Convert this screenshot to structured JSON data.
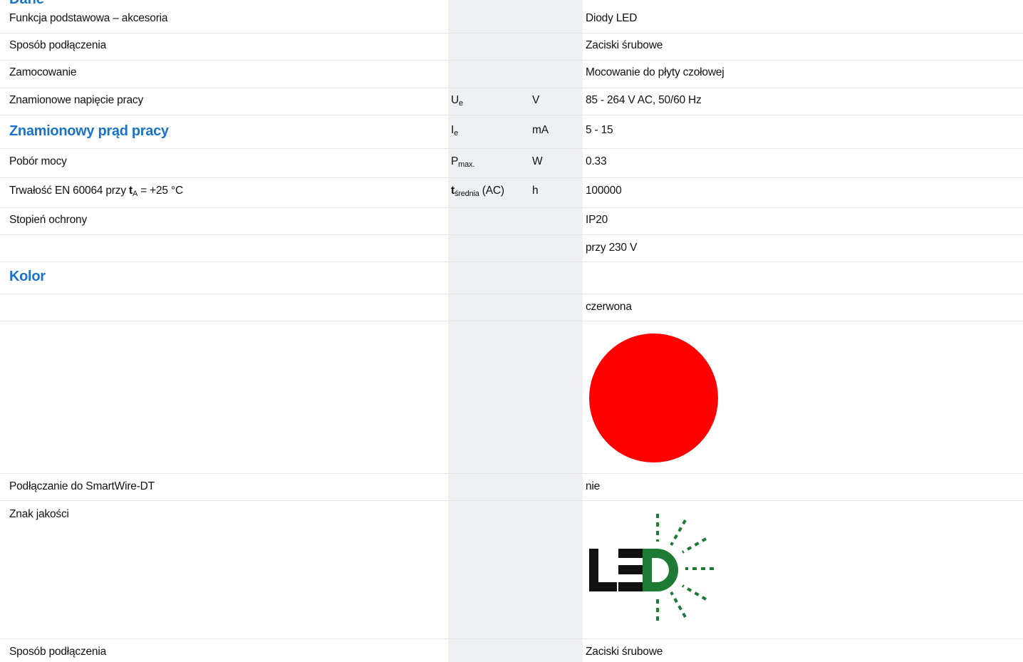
{
  "header_fragment": "Dane",
  "rows": [
    {
      "label": "Funkcja podstawowa – akcesoria",
      "symbol": "",
      "unit": "",
      "value": "Diody LED"
    },
    {
      "label": "Sposób podłączenia",
      "symbol": "",
      "unit": "",
      "value": "Zaciski śrubowe"
    },
    {
      "label": "Zamocowanie",
      "symbol": "",
      "unit": "",
      "value": "Mocowanie do płyty czołowej"
    },
    {
      "label": "Znamionowe napięcie pracy",
      "symbol": "U",
      "symbol_sub": "e",
      "unit": "V",
      "value": "85 - 264 V AC, 50/60 Hz"
    },
    {
      "label": "Znamionowy prąd pracy",
      "symbol": "I",
      "symbol_sub": "e",
      "unit": "mA",
      "value": "5 - 15"
    },
    {
      "label": "Pobór mocy",
      "symbol": "P",
      "symbol_sub": "max.",
      "unit": "W",
      "value": "0.33"
    },
    {
      "label_pre": "Trwałość EN 60064 przy ",
      "label_bold": "t",
      "label_sub": "A",
      "label_post": " = +25 °C",
      "symbol_bold": "t",
      "symbol_sub": "średnia",
      "symbol_post": " (AC)",
      "unit": "h",
      "value": "100000"
    },
    {
      "label": "Stopień ochrony",
      "symbol": "",
      "unit": "",
      "value": "IP20"
    },
    {
      "label": "",
      "symbol": "",
      "unit": "",
      "value": "przy 230 V"
    },
    {
      "label": "Kolor",
      "symbol": "",
      "unit": "",
      "value": ""
    },
    {
      "label": "",
      "symbol": "",
      "unit": "",
      "value": "czerwona"
    },
    {
      "label": "Podłączanie do SmartWire-DT",
      "symbol": "",
      "unit": "",
      "value": "nie"
    },
    {
      "label": "Znak jakości",
      "symbol": "",
      "unit": "",
      "value": ""
    },
    {
      "label": "Sposób podłączenia",
      "symbol": "",
      "unit": "",
      "value": "Zaciski śrubowe"
    }
  ],
  "colors": {
    "heading": "#1a73c8",
    "band": "#eef0f3",
    "led_color": "#ff0000",
    "logo_black": "#111111",
    "logo_green": "#1e7a34"
  },
  "icons": {
    "color_swatch": "red-circle",
    "quality_mark": "led-logo-icon"
  }
}
